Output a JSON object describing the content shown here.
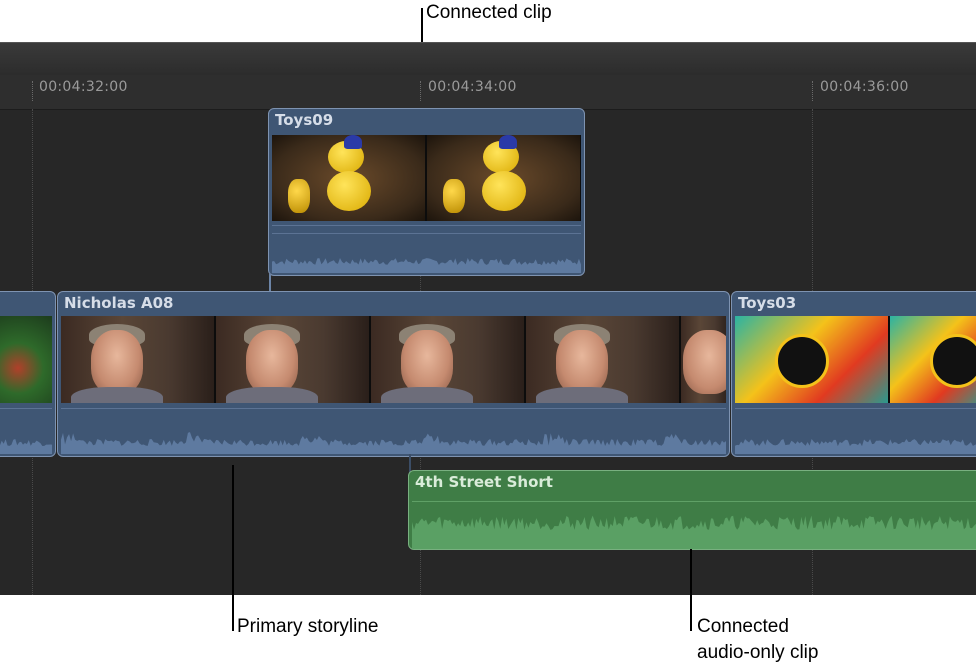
{
  "ruler": {
    "ticks": [
      "00:04:32:00",
      "00:04:34:00",
      "00:04:36:00"
    ]
  },
  "clips": {
    "connected_video": {
      "title": "Toys09"
    },
    "primary_left": {
      "title": ""
    },
    "primary_main": {
      "title": "Nicholas A08"
    },
    "primary_right": {
      "title": "Toys03"
    },
    "connected_audio": {
      "title": "4th Street Short"
    }
  },
  "callouts": {
    "connected_clip": "Connected clip",
    "primary_storyline": "Primary storyline",
    "audio_only_line1": "Connected",
    "audio_only_line2": "audio-only clip"
  },
  "colors": {
    "video_clip": "#3f5674",
    "audio_clip": "#3f7d46",
    "timeline_bg": "#272727"
  }
}
